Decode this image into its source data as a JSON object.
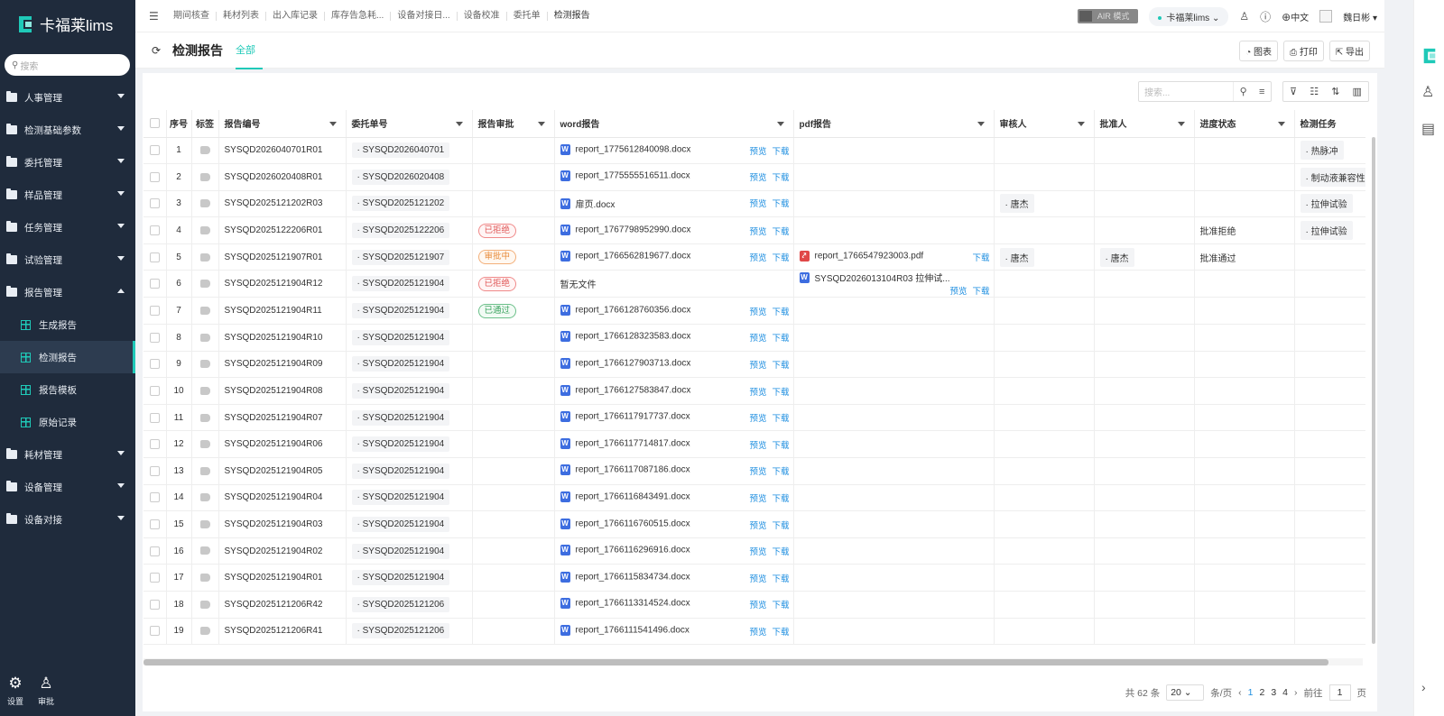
{
  "app": {
    "name": "卡福莱lims"
  },
  "sidebar": {
    "search_placeholder": "搜索",
    "menu": [
      {
        "label": "人事管理"
      },
      {
        "label": "检测基础参数"
      },
      {
        "label": "委托管理"
      },
      {
        "label": "样品管理"
      },
      {
        "label": "任务管理"
      },
      {
        "label": "试验管理"
      },
      {
        "label": "报告管理"
      }
    ],
    "submenu": [
      {
        "label": "生成报告"
      },
      {
        "label": "检测报告"
      },
      {
        "label": "报告模板"
      },
      {
        "label": "原始记录"
      }
    ],
    "menu_after": [
      {
        "label": "耗材管理"
      },
      {
        "label": "设备管理"
      },
      {
        "label": "设备对接"
      }
    ],
    "bottom": {
      "settings": "设置",
      "approval": "审批"
    }
  },
  "topbar": {
    "tabs": [
      "期间核查",
      "耗材列表",
      "出入库记录",
      "库存告急耗...",
      "设备对接日...",
      "设备校准",
      "委托单",
      "检测报告"
    ],
    "air_mode": "AIR 模式",
    "tenant": "卡福莱lims",
    "language": "中文",
    "user": "魏日彬"
  },
  "page": {
    "title": "检测报告",
    "tab_all": "全部",
    "btn_chart": "图表",
    "btn_print": "打印",
    "btn_export": "导出",
    "search_placeholder": "搜索..."
  },
  "table": {
    "columns": [
      "序号",
      "标签",
      "报告编号",
      "委托单号",
      "报告审批",
      "word报告",
      "pdf报告",
      "审核人",
      "批准人",
      "进度状态",
      "检测任务"
    ],
    "link_preview": "预览",
    "link_download": "下载",
    "rows": [
      {
        "no": "1",
        "report_no": "SYSQD2026040701R01",
        "order": "· SYSQD2026040701",
        "approval": "",
        "word": "report_1775612840098.docx",
        "pdf": "",
        "reviewer": "",
        "approver": "",
        "progress": "",
        "task": "· 热脉冲"
      },
      {
        "no": "2",
        "report_no": "SYSQD2026020408R01",
        "order": "· SYSQD2026020408",
        "approval": "",
        "word": "report_1775555516511.docx",
        "pdf": "",
        "reviewer": "",
        "approver": "",
        "progress": "",
        "task": "· 制动液兼容性"
      },
      {
        "no": "3",
        "report_no": "SYSQD2025121202R03",
        "order": "· SYSQD2025121202",
        "approval": "",
        "word": "扉页.docx",
        "pdf": "",
        "reviewer": "· 唐杰",
        "approver": "",
        "progress": "",
        "task": "· 拉伸试验"
      },
      {
        "no": "4",
        "report_no": "SYSQD2025122206R01",
        "order": "· SYSQD2025122206",
        "approval": "已拒绝",
        "word": "report_1767798952990.docx",
        "pdf": "",
        "reviewer": "",
        "approver": "",
        "progress": "批准拒绝",
        "task": "· 拉伸试验"
      },
      {
        "no": "5",
        "report_no": "SYSQD2025121907R01",
        "order": "· SYSQD2025121907",
        "approval": "审批中",
        "word": "report_1766562819677.docx",
        "pdf": "report_1766547923003.pdf",
        "reviewer": "· 唐杰",
        "approver": "· 唐杰",
        "progress": "批准通过",
        "task": ""
      },
      {
        "no": "6",
        "report_no": "SYSQD2025121904R12",
        "order": "· SYSQD2025121904",
        "approval": "已拒绝",
        "word": "暂无文件",
        "pdf": "SYSQD2026013104R03 拉伸试...",
        "reviewer": "",
        "approver": "",
        "progress": "",
        "task": ""
      },
      {
        "no": "7",
        "report_no": "SYSQD2025121904R11",
        "order": "· SYSQD2025121904",
        "approval": "已通过",
        "word": "report_1766128760356.docx",
        "pdf": "",
        "reviewer": "",
        "approver": "",
        "progress": "",
        "task": ""
      },
      {
        "no": "8",
        "report_no": "SYSQD2025121904R10",
        "order": "· SYSQD2025121904",
        "approval": "",
        "word": "report_1766128323583.docx",
        "pdf": "",
        "reviewer": "",
        "approver": "",
        "progress": "",
        "task": ""
      },
      {
        "no": "9",
        "report_no": "SYSQD2025121904R09",
        "order": "· SYSQD2025121904",
        "approval": "",
        "word": "report_1766127903713.docx",
        "pdf": "",
        "reviewer": "",
        "approver": "",
        "progress": "",
        "task": ""
      },
      {
        "no": "10",
        "report_no": "SYSQD2025121904R08",
        "order": "· SYSQD2025121904",
        "approval": "",
        "word": "report_1766127583847.docx",
        "pdf": "",
        "reviewer": "",
        "approver": "",
        "progress": "",
        "task": ""
      },
      {
        "no": "11",
        "report_no": "SYSQD2025121904R07",
        "order": "· SYSQD2025121904",
        "approval": "",
        "word": "report_1766117917737.docx",
        "pdf": "",
        "reviewer": "",
        "approver": "",
        "progress": "",
        "task": ""
      },
      {
        "no": "12",
        "report_no": "SYSQD2025121904R06",
        "order": "· SYSQD2025121904",
        "approval": "",
        "word": "report_1766117714817.docx",
        "pdf": "",
        "reviewer": "",
        "approver": "",
        "progress": "",
        "task": ""
      },
      {
        "no": "13",
        "report_no": "SYSQD2025121904R05",
        "order": "· SYSQD2025121904",
        "approval": "",
        "word": "report_1766117087186.docx",
        "pdf": "",
        "reviewer": "",
        "approver": "",
        "progress": "",
        "task": ""
      },
      {
        "no": "14",
        "report_no": "SYSQD2025121904R04",
        "order": "· SYSQD2025121904",
        "approval": "",
        "word": "report_1766116843491.docx",
        "pdf": "",
        "reviewer": "",
        "approver": "",
        "progress": "",
        "task": ""
      },
      {
        "no": "15",
        "report_no": "SYSQD2025121904R03",
        "order": "· SYSQD2025121904",
        "approval": "",
        "word": "report_1766116760515.docx",
        "pdf": "",
        "reviewer": "",
        "approver": "",
        "progress": "",
        "task": ""
      },
      {
        "no": "16",
        "report_no": "SYSQD2025121904R02",
        "order": "· SYSQD2025121904",
        "approval": "",
        "word": "report_1766116296916.docx",
        "pdf": "",
        "reviewer": "",
        "approver": "",
        "progress": "",
        "task": ""
      },
      {
        "no": "17",
        "report_no": "SYSQD2025121904R01",
        "order": "· SYSQD2025121904",
        "approval": "",
        "word": "report_1766115834734.docx",
        "pdf": "",
        "reviewer": "",
        "approver": "",
        "progress": "",
        "task": ""
      },
      {
        "no": "18",
        "report_no": "SYSQD2025121206R42",
        "order": "· SYSQD2025121206",
        "approval": "",
        "word": "report_1766113314524.docx",
        "pdf": "",
        "reviewer": "",
        "approver": "",
        "progress": "",
        "task": ""
      },
      {
        "no": "19",
        "report_no": "SYSQD2025121206R41",
        "order": "· SYSQD2025121206",
        "approval": "",
        "word": "report_1766111541496.docx",
        "pdf": "",
        "reviewer": "",
        "approver": "",
        "progress": "",
        "task": ""
      }
    ]
  },
  "pager": {
    "total": "共 62 条",
    "page_size": "20",
    "per_page": "条/页",
    "pages": [
      "1",
      "2",
      "3",
      "4"
    ],
    "goto": "前往",
    "current": "1",
    "page_unit": "页"
  },
  "colors": {
    "accent": "#1fc9b8",
    "sidebar": "#1f2b3c",
    "link": "#1f8fe0"
  }
}
